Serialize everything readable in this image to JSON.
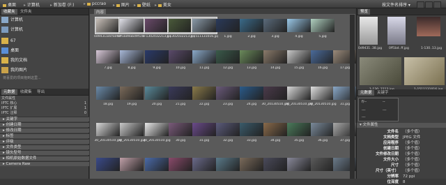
{
  "breadcrumb": [
    "桌面",
    "计算机",
    "新加卷 (F:)",
    "pccrao",
    "图片",
    "壁纸",
    "美女"
  ],
  "top_right": {
    "label": "按文件名排序"
  },
  "left_panel": {
    "tabs": [
      "收藏夹",
      "文件夹"
    ],
    "favorites": [
      "计算机",
      "计算机",
      "67",
      "桌面",
      "我的文档",
      "我的图片"
    ],
    "favorites_hint": "将喜爱的项目拖到这里...",
    "lower_tabs": [
      "元数据",
      "收藏集",
      "导出"
    ],
    "metadata_rows": [
      {
        "k": "文件属性",
        "v": ""
      },
      {
        "k": "IPTC 核心",
        "v": "1"
      },
      {
        "k": "IPTC 扩展",
        "v": "1"
      },
      {
        "k": "IPTC 注释",
        "v": "0"
      }
    ],
    "categories": [
      "关键字",
      "创建日期",
      "修改日期",
      "标签",
      "评级",
      "文件类型",
      "镜头型号",
      "相机原始数据文件",
      "Camera Raw"
    ]
  },
  "content": {
    "header_label": "内容",
    "thumb_labels_row1": [
      "0d9431adcfa060-1.jpg",
      "0ff1bd9abd9f1de-1.jpg",
      "1-1302032213.jpg",
      "1-1302032213.jpg",
      "1-1511131016.jpg",
      "1.jpg",
      "2.jpg",
      "3.jpg",
      "4.jpg",
      "5.jpg"
    ],
    "thumb_labels_row2": [
      "7.jpg",
      "8.jpg",
      "9.jpg",
      "10.jpg",
      "11.jpg",
      "12.jpg",
      "13.jpg",
      "14.jpg",
      "15.jpg",
      "16.jpg",
      "17.jpg"
    ],
    "thumb_labels_row3": [
      "18.jpg",
      "19.jpg",
      "20.jpg",
      "21.jpg",
      "22.jpg",
      "23.jpg",
      "24.jpg",
      "30_20130510.jpg",
      "30_20130510.jpg",
      "30_20130510.jpg",
      "31.jpg"
    ],
    "thumb_labels_row4": [
      "30_20130510.jpg",
      "30_20130510.jpg",
      "30_20130510.jpg",
      "30.jpg",
      "31.jpg",
      "32.jpg",
      "33.jpg",
      "34.jpg",
      "35.jpg",
      "36.jpg",
      "37.jpg"
    ]
  },
  "right_panel": {
    "preview_tab": "预览",
    "preview_captions": [
      "0d9431..38.jpg",
      "0ff1bd..ff.jpg",
      "1-130..13.jpg",
      "1-130..2213.jpg",
      "1-1511131016.jpg"
    ],
    "lower_tabs": [
      "元数据",
      "关键字"
    ],
    "section_title": "文件属性",
    "properties": [
      {
        "k": "文件名",
        "v": "（多个值）"
      },
      {
        "k": "文档类型",
        "v": "JPEG 文件"
      },
      {
        "k": "应用程序",
        "v": "（多个值）"
      },
      {
        "k": "创建日期",
        "v": "（多个值）"
      },
      {
        "k": "文件修改日期",
        "v": "（多个值）"
      },
      {
        "k": "文件大小",
        "v": "（多个值）"
      },
      {
        "k": "尺寸",
        "v": "（多个值）"
      },
      {
        "k": "尺寸（英寸）",
        "v": "（多个值）"
      },
      {
        "k": "分辨率",
        "v": "72 ppi"
      },
      {
        "k": "位深度",
        "v": "8"
      }
    ],
    "small_values": [
      "f/--",
      "--",
      "---",
      "---",
      "---"
    ]
  },
  "colors": {
    "bg": "#3a3a3a",
    "content": "#5a5a5a",
    "selected": "#b8b8b8",
    "folder": "#d9b24a"
  }
}
